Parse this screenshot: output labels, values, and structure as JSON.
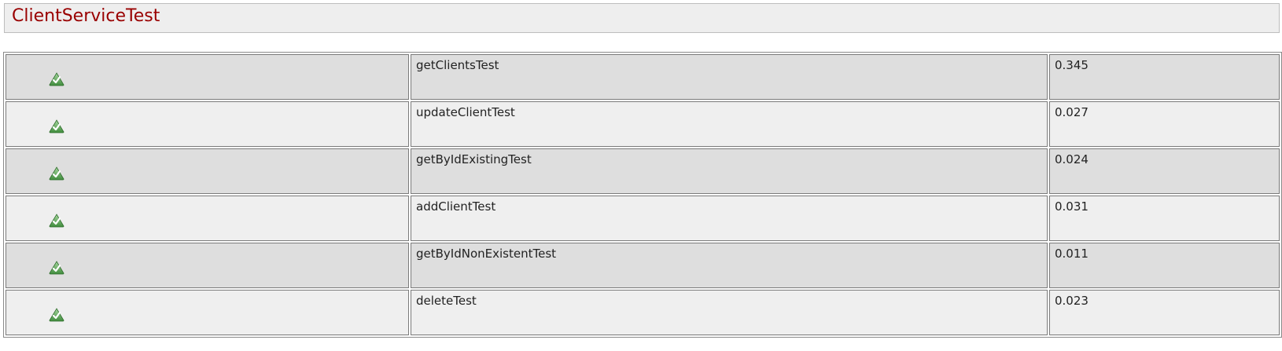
{
  "suite": {
    "title": "ClientServiceTest"
  },
  "status_icon": "pass-check-icon",
  "colors": {
    "title": "#990000",
    "row_odd": "#dedede",
    "row_even": "#efefef",
    "pass_icon": "#4f9a4a"
  },
  "tests": [
    {
      "name": "getClientsTest",
      "time": "0.345",
      "status": "passed"
    },
    {
      "name": "updateClientTest",
      "time": "0.027",
      "status": "passed"
    },
    {
      "name": "getByIdExistingTest",
      "time": "0.024",
      "status": "passed"
    },
    {
      "name": "addClientTest",
      "time": "0.031",
      "status": "passed"
    },
    {
      "name": "getByIdNonExistentTest",
      "time": "0.011",
      "status": "passed"
    },
    {
      "name": "deleteTest",
      "time": "0.023",
      "status": "passed"
    }
  ]
}
